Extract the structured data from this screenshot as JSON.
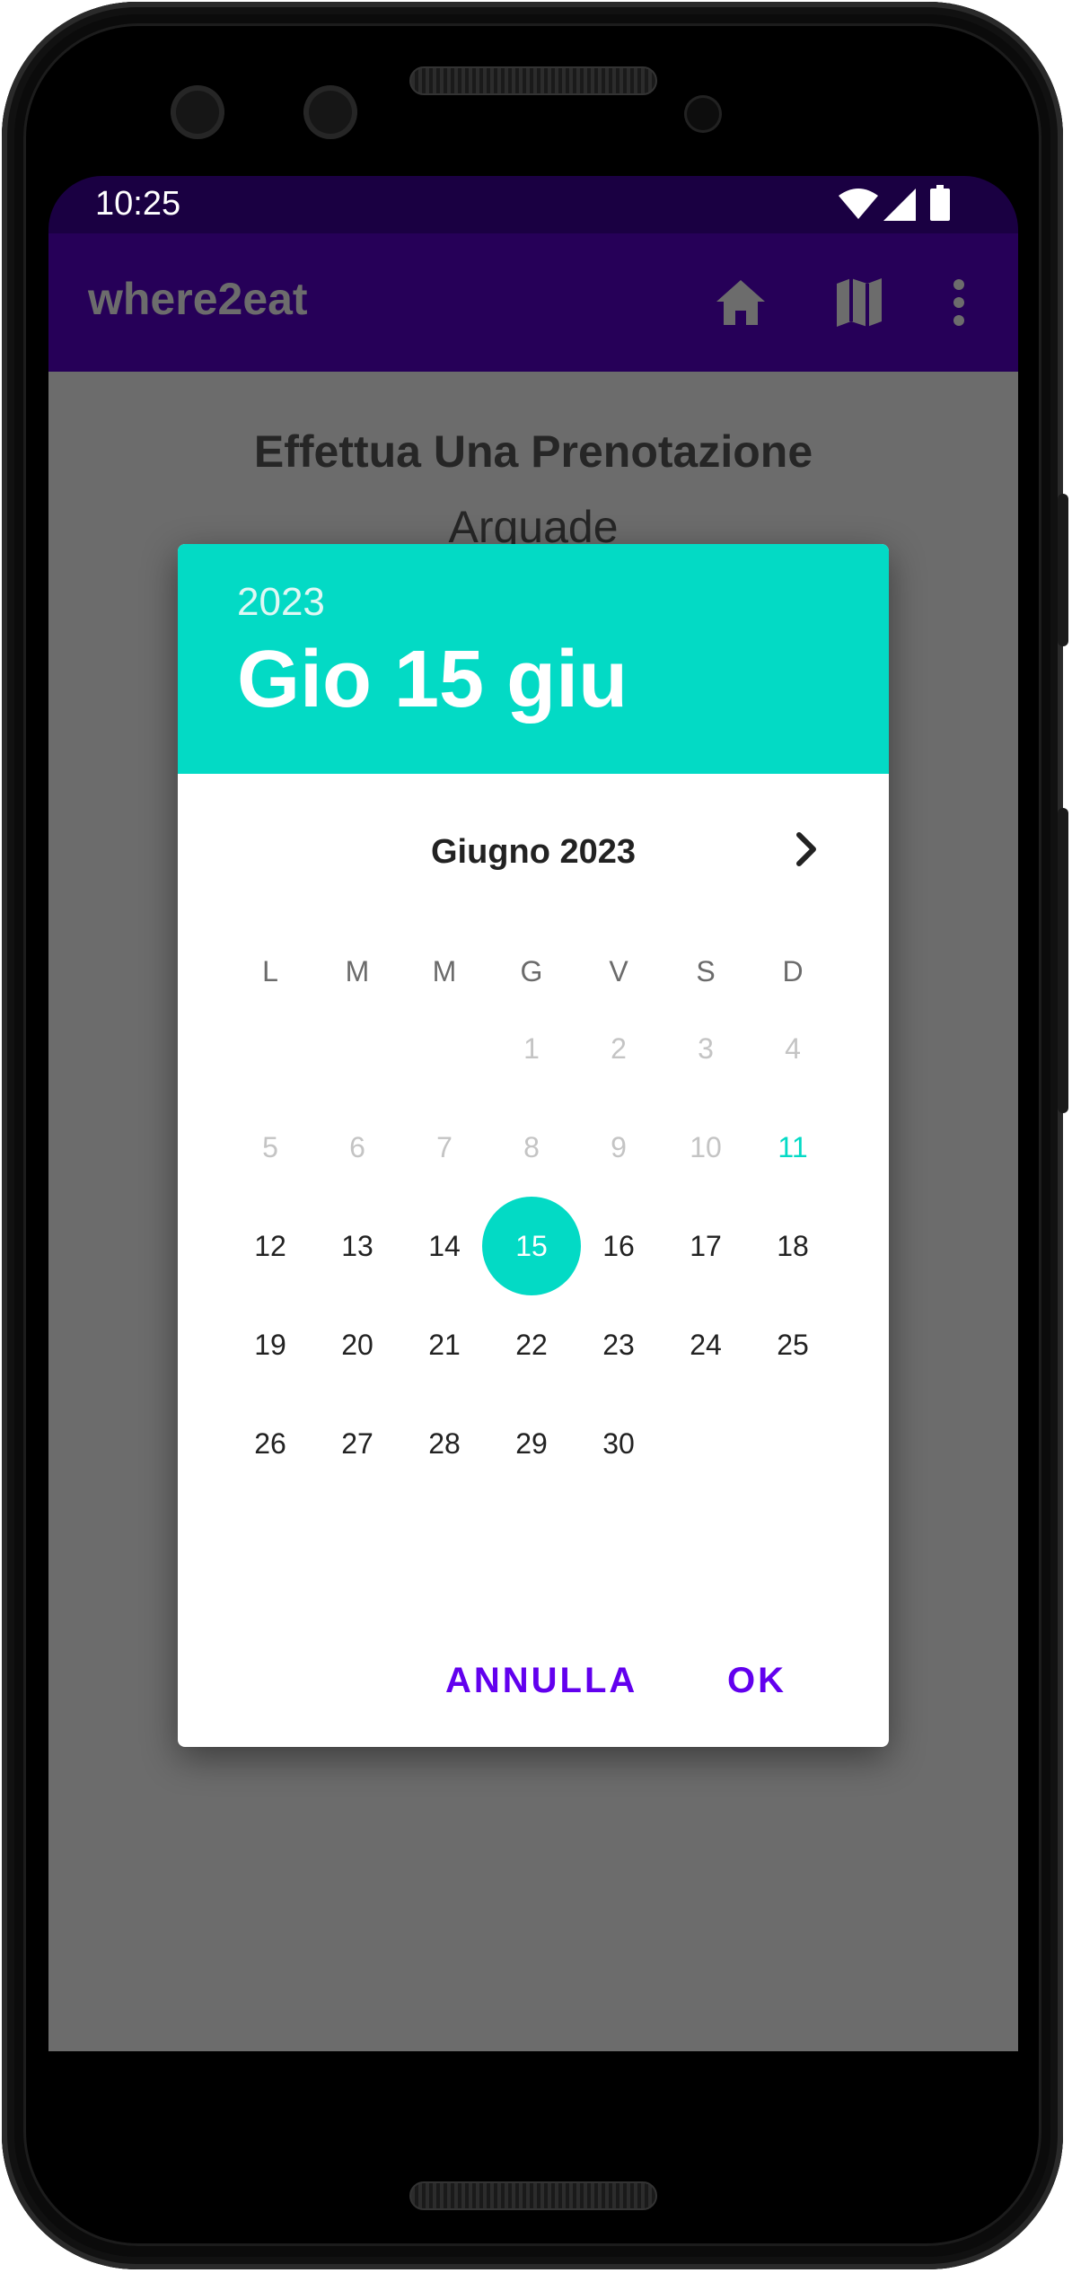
{
  "status_bar": {
    "time": "10:25"
  },
  "app_bar": {
    "title": "where2eat",
    "icons": [
      "home-icon",
      "map-icon",
      "more-vert-icon"
    ]
  },
  "page": {
    "title": "Effettua Una Prenotazione",
    "restaurant": "Arquade"
  },
  "date_picker": {
    "year": "2023",
    "selected_date": "Gio 15 giu",
    "month_label": "Giugno 2023",
    "weekdays": [
      "L",
      "M",
      "M",
      "G",
      "V",
      "S",
      "D"
    ],
    "weeks": [
      [
        "",
        "",
        "",
        "1",
        "2",
        "3",
        "4"
      ],
      [
        "5",
        "6",
        "7",
        "8",
        "9",
        "10",
        "11"
      ],
      [
        "12",
        "13",
        "14",
        "15",
        "16",
        "17",
        "18"
      ],
      [
        "19",
        "20",
        "21",
        "22",
        "23",
        "24",
        "25"
      ],
      [
        "26",
        "27",
        "28",
        "29",
        "30",
        "",
        ""
      ]
    ],
    "today": "11",
    "selected_day": "15",
    "cancel_label": "ANNULLA",
    "ok_label": "OK"
  },
  "colors": {
    "status_bar": "#1a0042",
    "app_bar": "#260058",
    "accent": "#03dac5",
    "button_text": "#6200ee",
    "scrim": "#6c6c6c"
  }
}
